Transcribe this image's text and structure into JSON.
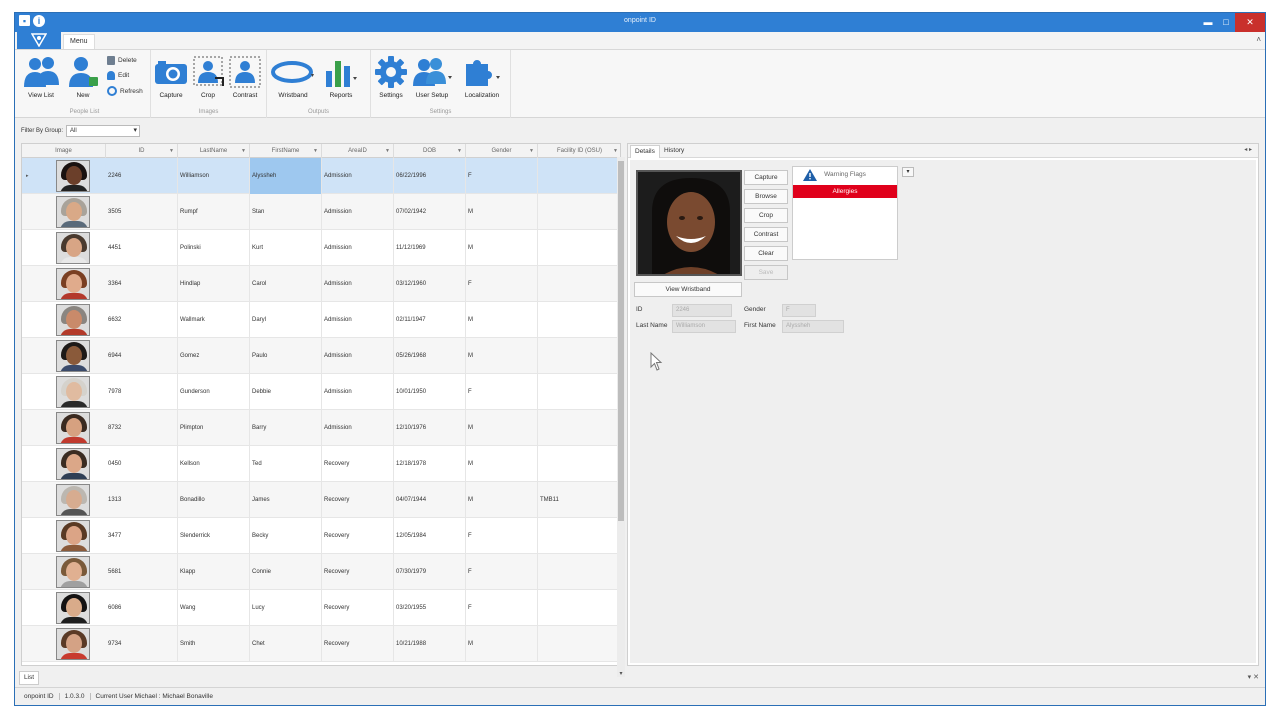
{
  "window": {
    "title": "onpoint ID"
  },
  "menu": {
    "tab_label": "Menu"
  },
  "ribbon": {
    "people_list": {
      "label": "People List",
      "view_list": "View List",
      "new": "New",
      "delete": "Delete",
      "edit": "Edit",
      "refresh": "Refresh"
    },
    "images": {
      "label": "Images",
      "capture": "Capture",
      "crop": "Crop",
      "contrast": "Contrast"
    },
    "outputs": {
      "label": "Outputs",
      "wristband": "Wristband",
      "reports": "Reports"
    },
    "settings": {
      "label": "Settings",
      "settings": "Settings",
      "user_setup": "User Setup",
      "localization": "Localization"
    }
  },
  "filter": {
    "label": "Filter By Group:",
    "value": "All"
  },
  "grid": {
    "columns": [
      "Image",
      "ID",
      "LastName",
      "FirstName",
      "AreaID",
      "DOB",
      "Gender",
      "Facility ID (OSU)"
    ],
    "rows": [
      {
        "id": "2246",
        "last": "Williamson",
        "first": "Alyssheh",
        "area": "Admission",
        "dob": "06/22/1996",
        "gender": "F",
        "fac": "",
        "skin": "#6b3f2a",
        "hair": "#1a1210",
        "shirt": "#222"
      },
      {
        "id": "3505",
        "last": "Rumpf",
        "first": "Stan",
        "area": "Admission",
        "dob": "07/02/1942",
        "gender": "M",
        "fac": "",
        "skin": "#d9a987",
        "hair": "#a9a39a",
        "shirt": "#5a6a7a"
      },
      {
        "id": "4451",
        "last": "Polinski",
        "first": "Kurt",
        "area": "Admission",
        "dob": "11/12/1969",
        "gender": "M",
        "fac": "",
        "skin": "#d8a585",
        "hair": "#4a3a2e",
        "shirt": "#e8e8e8"
      },
      {
        "id": "3364",
        "last": "Hindlap",
        "first": "Carol",
        "area": "Admission",
        "dob": "03/12/1960",
        "gender": "F",
        "fac": "",
        "skin": "#e0ab8c",
        "hair": "#7a3f22",
        "shirt": "#b3382b"
      },
      {
        "id": "6632",
        "last": "Wallmark",
        "first": "Daryl",
        "area": "Admission",
        "dob": "02/11/1947",
        "gender": "M",
        "fac": "",
        "skin": "#c98a6a",
        "hair": "#8a8580",
        "shirt": "#b33a2a"
      },
      {
        "id": "6944",
        "last": "Gomez",
        "first": "Paulo",
        "area": "Admission",
        "dob": "05/26/1968",
        "gender": "M",
        "fac": "",
        "skin": "#8a5a3a",
        "hair": "#1e1a18",
        "shirt": "#3a4a6a"
      },
      {
        "id": "7978",
        "last": "Gunderson",
        "first": "Debbie",
        "area": "Admission",
        "dob": "10/01/1950",
        "gender": "F",
        "fac": "",
        "skin": "#e0bba0",
        "hair": "#d5d2cc",
        "shirt": "#2a2a2a"
      },
      {
        "id": "8732",
        "last": "Plimpton",
        "first": "Barry",
        "area": "Admission",
        "dob": "12/10/1976",
        "gender": "M",
        "fac": "",
        "skin": "#d6a180",
        "hair": "#3a2a20",
        "shirt": "#c03a2e"
      },
      {
        "id": "0450",
        "last": "Kellson",
        "first": "Ted",
        "area": "Recovery",
        "dob": "12/18/1978",
        "gender": "M",
        "fac": "",
        "skin": "#dba788",
        "hair": "#3a2c22",
        "shirt": "#2f3f55"
      },
      {
        "id": "1313",
        "last": "Bonadillo",
        "first": "James",
        "area": "Recovery",
        "dob": "04/07/1944",
        "gender": "M",
        "fac": "TMB11",
        "skin": "#d7ac90",
        "hair": "#bcb7b0",
        "shirt": "#555"
      },
      {
        "id": "3477",
        "last": "Slenderrick",
        "first": "Becky",
        "area": "Recovery",
        "dob": "12/05/1984",
        "gender": "F",
        "fac": "",
        "skin": "#dba486",
        "hair": "#5a3a24",
        "shirt": "#8a5a3a"
      },
      {
        "id": "5681",
        "last": "Klapp",
        "first": "Connie",
        "area": "Recovery",
        "dob": "07/30/1979",
        "gender": "F",
        "fac": "",
        "skin": "#e0b091",
        "hair": "#7a5a3a",
        "shirt": "#a0a0a0"
      },
      {
        "id": "6086",
        "last": "Wang",
        "first": "Lucy",
        "area": "Recovery",
        "dob": "03/20/1955",
        "gender": "F",
        "fac": "",
        "skin": "#d9ab8a",
        "hair": "#141212",
        "shirt": "#1e1e1e"
      },
      {
        "id": "9734",
        "last": "Smith",
        "first": "Chet",
        "area": "Recovery",
        "dob": "10/21/1988",
        "gender": "M",
        "fac": "",
        "skin": "#d4a285",
        "hair": "#5a3a26",
        "shirt": "#c83a2e"
      }
    ]
  },
  "panel": {
    "tabs": [
      "Details",
      "History"
    ],
    "buttons": [
      "Capture",
      "Browse",
      "Crop",
      "Contrast",
      "Clear",
      "Save"
    ],
    "warning_title": "Warning Flags",
    "warning_flag": "Allergies",
    "view_wristband": "View Wristband",
    "fields": {
      "id_label": "ID",
      "id_value": "2246",
      "gender_label": "Gender",
      "gender_value": "F",
      "last_label": "Last Name",
      "last_value": "Williamson",
      "first_label": "First Name",
      "first_value": "Alyssheh"
    }
  },
  "bottom": {
    "tab": "List"
  },
  "status": {
    "app": "onpoint ID",
    "version": "1.0.3.0",
    "user": "Current User Michael : Michael Bonaville"
  },
  "colors": {
    "accent": "#2f7fd4",
    "selected_row": "#cfe3f7",
    "allergy": "#e0001b",
    "close_button": "#c9302c"
  }
}
